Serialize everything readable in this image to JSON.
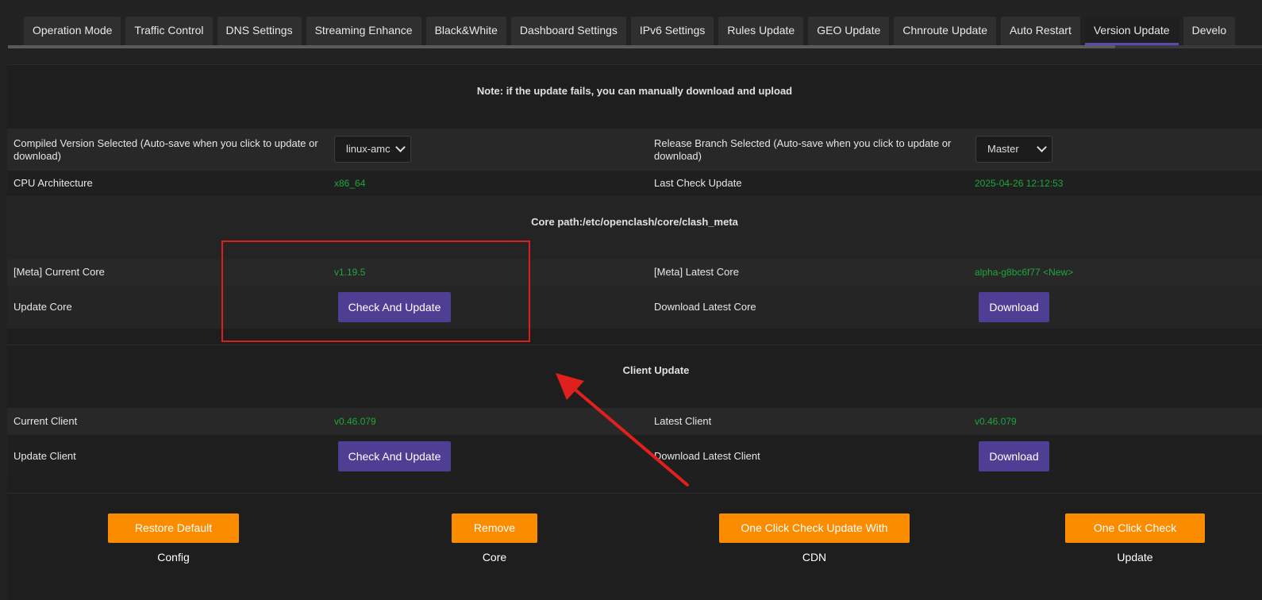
{
  "tabs": [
    {
      "label": "Operation Mode",
      "active": false
    },
    {
      "label": "Traffic Control",
      "active": false
    },
    {
      "label": "DNS Settings",
      "active": false
    },
    {
      "label": "Streaming Enhance",
      "active": false
    },
    {
      "label": "Black&White",
      "active": false
    },
    {
      "label": "Dashboard Settings",
      "active": false
    },
    {
      "label": "IPv6 Settings",
      "active": false
    },
    {
      "label": "Rules Update",
      "active": false
    },
    {
      "label": "GEO Update",
      "active": false
    },
    {
      "label": "Chnroute Update",
      "active": false
    },
    {
      "label": "Auto Restart",
      "active": false
    },
    {
      "label": "Version Update",
      "active": true
    },
    {
      "label": "Develo",
      "active": false
    }
  ],
  "note": "Note: if the update fails, you can manually download and upload",
  "compiled": {
    "label": "Compiled Version Selected (Auto-save when you click to update or download)",
    "value": "linux-amc"
  },
  "branch": {
    "label": "Release Branch Selected (Auto-save when you click to update or download)",
    "value": "Master"
  },
  "cpu": {
    "label": "CPU Architecture",
    "value": "x86_64"
  },
  "last_check": {
    "label": "Last Check Update",
    "value": "2025-04-26 12:12:53"
  },
  "core_path": "Core path:/etc/openclash/core/clash_meta",
  "current_core": {
    "label": "[Meta] Current Core",
    "value": "v1.19.5"
  },
  "latest_core": {
    "label": "[Meta] Latest Core",
    "value": "alpha-g8bc6f77 <New>"
  },
  "update_core": {
    "label": "Update Core",
    "button": "Check And Update"
  },
  "download_core": {
    "label": "Download Latest Core",
    "button": "Download"
  },
  "client_update_title": "Client Update",
  "current_client": {
    "label": "Current Client",
    "value": "v0.46.079"
  },
  "latest_client": {
    "label": "Latest Client",
    "value": "v0.46.079"
  },
  "update_client": {
    "label": "Update Client",
    "button": "Check And Update"
  },
  "download_client": {
    "label": "Download Latest Client",
    "button": "Download"
  },
  "actions": {
    "restore": "Restore Default Config",
    "remove_core": "Remove Core",
    "cdn_update": "One Click Check Update With CDN",
    "check_update": "One Click Check Update"
  },
  "colors": {
    "accent_purple": "#4f3f94",
    "accent_orange": "#fb8c00",
    "value_green": "#1da73a",
    "annotation_red": "#d9201d"
  }
}
